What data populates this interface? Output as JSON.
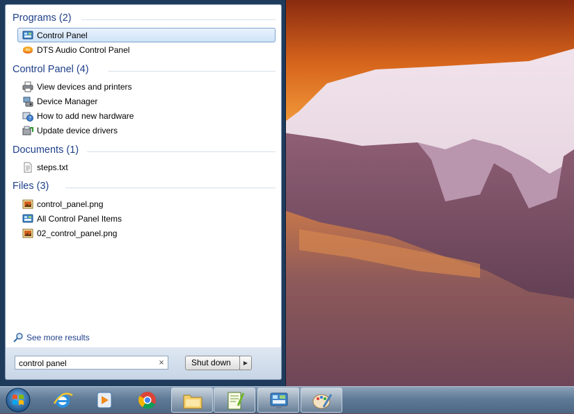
{
  "start_menu": {
    "groups": [
      {
        "header": "Programs (2)",
        "items": [
          {
            "label": "Control Panel",
            "icon": "control-panel-icon",
            "selected": true
          },
          {
            "label": "DTS Audio Control Panel",
            "icon": "dts-audio-icon",
            "selected": false
          }
        ]
      },
      {
        "header": "Control Panel (4)",
        "items": [
          {
            "label": "View devices and printers",
            "icon": "printer-icon"
          },
          {
            "label": "Device Manager",
            "icon": "device-manager-icon"
          },
          {
            "label": "How to add new hardware",
            "icon": "hardware-help-icon"
          },
          {
            "label": "Update device drivers",
            "icon": "device-driver-icon"
          }
        ]
      },
      {
        "header": "Documents (1)",
        "items": [
          {
            "label": "steps.txt",
            "icon": "text-file-icon"
          }
        ]
      },
      {
        "header": "Files (3)",
        "items": [
          {
            "label": "control_panel.png",
            "icon": "image-file-icon"
          },
          {
            "label": "All Control Panel Items",
            "icon": "control-panel-icon"
          },
          {
            "label": "02_control_panel.png",
            "icon": "image-file-icon"
          }
        ]
      }
    ],
    "see_more": "See more results",
    "search_value": "control panel",
    "clear_glyph": "×",
    "shutdown_label": "Shut down",
    "shutdown_arrow_glyph": "▶"
  },
  "taskbar": {
    "pinned": [
      {
        "name": "internet-explorer",
        "icon": "internet-explorer-icon",
        "open": false
      },
      {
        "name": "media-player",
        "icon": "media-player-icon",
        "open": false
      },
      {
        "name": "chrome",
        "icon": "chrome-icon",
        "open": false
      },
      {
        "name": "explorer",
        "icon": "file-explorer-icon",
        "open": true
      },
      {
        "name": "notepad-plus-plus",
        "icon": "notepad-plus-plus-icon",
        "open": true
      },
      {
        "name": "control-panel",
        "icon": "control-panel-icon",
        "open": true
      },
      {
        "name": "paint",
        "icon": "paint-icon",
        "open": true
      }
    ]
  },
  "colors": {
    "group_header": "#1e3f8a",
    "selection_border": "#7da2ce",
    "menu_frame": "#1f3b5c"
  }
}
